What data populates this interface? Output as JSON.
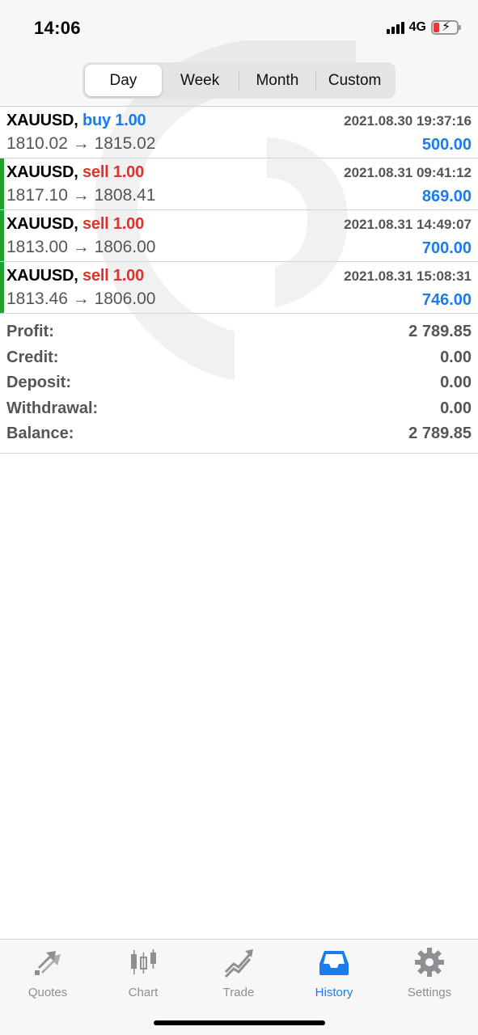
{
  "status": {
    "time": "14:06",
    "network": "4G"
  },
  "period_tabs": [
    {
      "label": "Day",
      "active": true
    },
    {
      "label": "Week",
      "active": false
    },
    {
      "label": "Month",
      "active": false
    },
    {
      "label": "Custom",
      "active": false
    }
  ],
  "trades": [
    {
      "symbol": "XAUUSD,",
      "direction": "buy 1.00",
      "time": "2021.08.30 19:37:16",
      "prices": "1810.02 → 1815.02",
      "profit": "500.00"
    },
    {
      "symbol": "XAUUSD,",
      "direction": "sell 1.00",
      "time": "2021.08.31 09:41:12",
      "prices": "1817.10 → 1808.41",
      "profit": "869.00"
    },
    {
      "symbol": "XAUUSD,",
      "direction": "sell 1.00",
      "time": "2021.08.31 14:49:07",
      "prices": "1813.00 → 1806.00",
      "profit": "700.00"
    },
    {
      "symbol": "XAUUSD,",
      "direction": "sell 1.00",
      "time": "2021.08.31 15:08:31",
      "prices": "1813.46 → 1806.00",
      "profit": "746.00"
    }
  ],
  "summary": [
    {
      "label": "Profit:",
      "value": "2 789.85"
    },
    {
      "label": "Credit:",
      "value": "0.00"
    },
    {
      "label": "Deposit:",
      "value": "0.00"
    },
    {
      "label": "Withdrawal:",
      "value": "0.00"
    },
    {
      "label": "Balance:",
      "value": "2 789.85"
    }
  ],
  "tabbar": [
    {
      "label": "Quotes",
      "icon": "quotes-icon",
      "active": false
    },
    {
      "label": "Chart",
      "icon": "chart-icon",
      "active": false
    },
    {
      "label": "Trade",
      "icon": "trade-icon",
      "active": false
    },
    {
      "label": "History",
      "icon": "history-icon",
      "active": true
    },
    {
      "label": "Settings",
      "icon": "settings-icon",
      "active": false
    }
  ],
  "colors": {
    "accent": "#1a7cf0",
    "sell": "#e0322a",
    "marker": "#1fa12c",
    "inactive": "#8e8e93"
  }
}
